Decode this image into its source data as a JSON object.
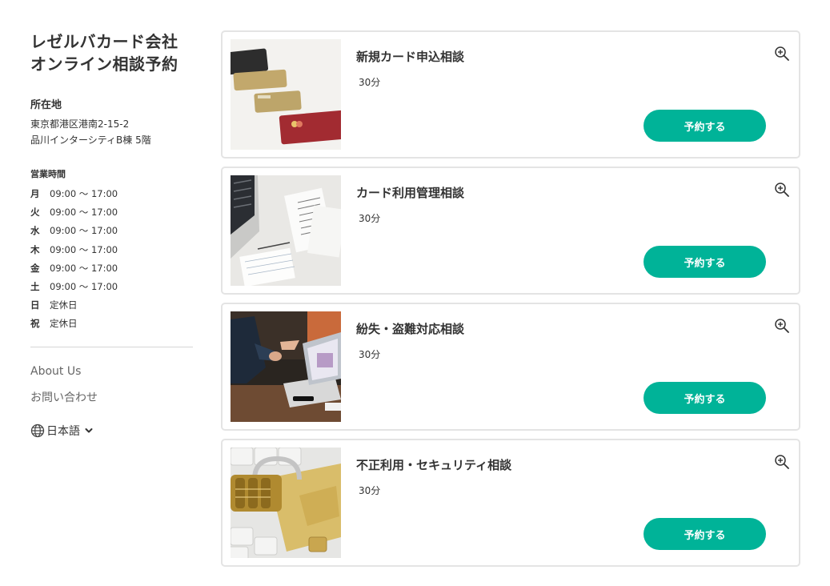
{
  "company": {
    "title_line1": "レゼルバカード会社",
    "title_line2": "オンライン相談予約"
  },
  "location": {
    "heading": "所在地",
    "address_line1": "東京都港区港南2-15-2",
    "address_line2": "品川インターシティB棟 5階"
  },
  "hours": {
    "heading": "営業時間",
    "rows": [
      {
        "day": "月",
        "time": "09:00 〜 17:00"
      },
      {
        "day": "火",
        "time": "09:00 〜 17:00"
      },
      {
        "day": "水",
        "time": "09:00 〜 17:00"
      },
      {
        "day": "木",
        "time": "09:00 〜 17:00"
      },
      {
        "day": "金",
        "time": "09:00 〜 17:00"
      },
      {
        "day": "土",
        "time": "09:00 〜 17:00"
      },
      {
        "day": "日",
        "time": "定休日"
      },
      {
        "day": "祝",
        "time": "定休日"
      }
    ]
  },
  "links": {
    "about": "About Us",
    "contact": "お問い合わせ"
  },
  "language": {
    "selected": "日本語",
    "icon": "globe-icon"
  },
  "colors": {
    "accent": "#00b398",
    "border": "#e4e4e4",
    "text": "#333333"
  },
  "services": [
    {
      "title": "新規カード申込相談",
      "duration": "30分",
      "button": "予約する",
      "image": "credit-cards-image"
    },
    {
      "title": "カード利用管理相談",
      "duration": "30分",
      "button": "予約する",
      "image": "laptop-receipts-image"
    },
    {
      "title": "紛失・盗難対応相談",
      "duration": "30分",
      "button": "予約する",
      "image": "business-meeting-image"
    },
    {
      "title": "不正利用・セキュリティ相談",
      "duration": "30分",
      "button": "予約する",
      "image": "padlock-cards-image"
    }
  ]
}
